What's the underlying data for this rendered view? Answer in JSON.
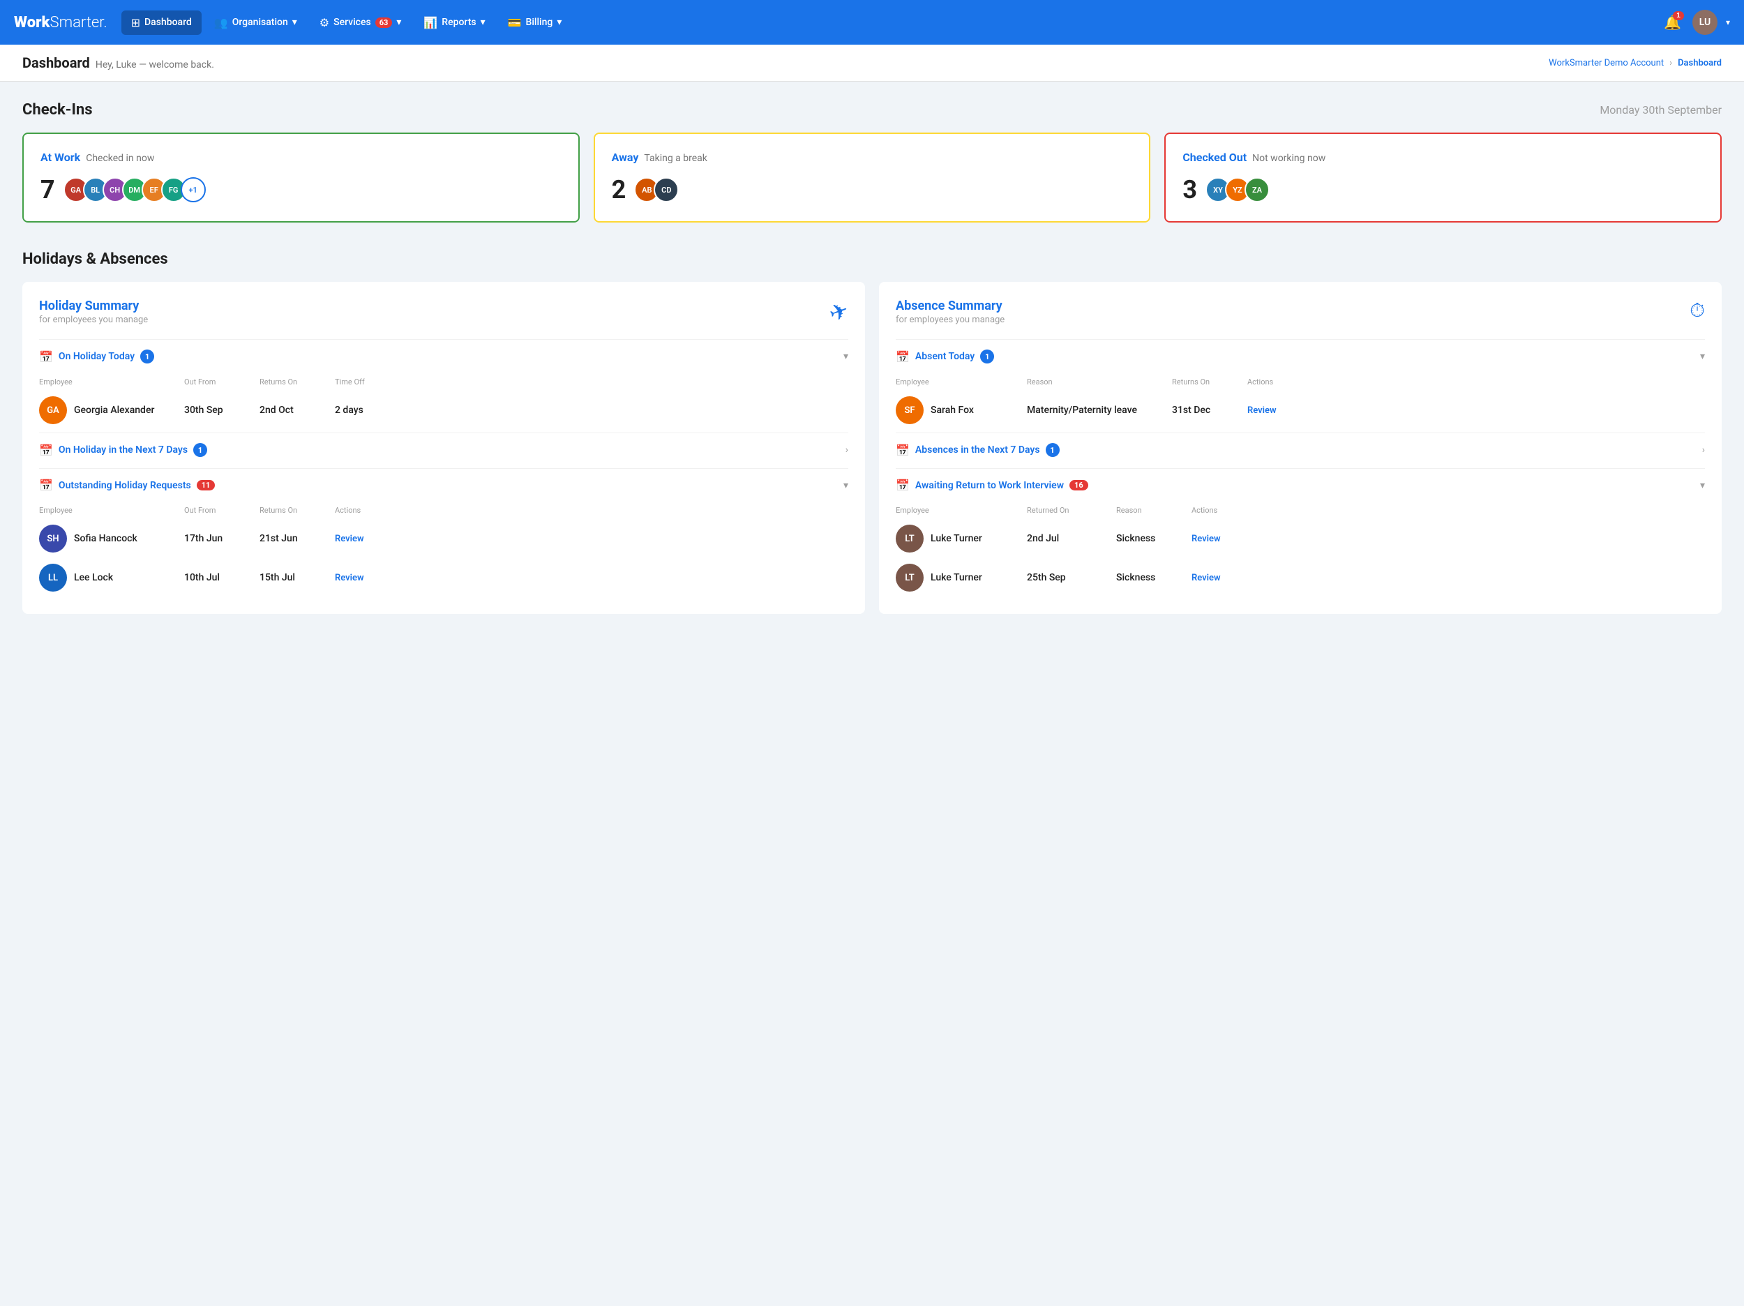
{
  "brand": "WorkSmarter.",
  "nav": {
    "items": [
      {
        "label": "Dashboard",
        "active": true,
        "icon": "⊞"
      },
      {
        "label": "Organisation",
        "active": false,
        "icon": "👥",
        "dropdown": true
      },
      {
        "label": "Services",
        "active": false,
        "icon": "⚙",
        "dropdown": true,
        "badge": "63"
      },
      {
        "label": "Reports",
        "active": false,
        "icon": "📊",
        "dropdown": true
      },
      {
        "label": "Billing",
        "active": false,
        "icon": "💳",
        "dropdown": true
      }
    ],
    "notifications_count": "1",
    "user_initials": "LU"
  },
  "breadcrumb": {
    "title": "Dashboard",
    "subtitle": "Hey, Luke — welcome back.",
    "account_link": "WorkSmarter Demo Account",
    "current": "Dashboard"
  },
  "checkins": {
    "section_title": "Check-Ins",
    "date": "Monday 30th September",
    "cards": [
      {
        "status": "At Work",
        "description": "Checked in now",
        "count": "7",
        "border": "green",
        "avatars": [
          "GA",
          "BL",
          "CH",
          "DM",
          "EF",
          "FG"
        ],
        "extra": "+1"
      },
      {
        "status": "Away",
        "description": "Taking a break",
        "count": "2",
        "border": "yellow",
        "avatars": [
          "AB",
          "CD"
        ],
        "extra": null
      },
      {
        "status": "Checked Out",
        "description": "Not working now",
        "count": "3",
        "border": "red",
        "avatars": [
          "XY",
          "YZ",
          "ZA"
        ],
        "extra": null
      }
    ]
  },
  "holidays_absences": {
    "section_title": "Holidays & Absences",
    "holiday_card": {
      "title": "Holiday Summary",
      "subtitle": "for employees you manage",
      "on_holiday_today": {
        "label": "On Holiday Today",
        "count": "1",
        "employee": {
          "name": "Georgia Alexander",
          "out_from": "30th Sep",
          "returns_on": "2nd Oct",
          "time_off": "2 days"
        },
        "col_labels": [
          "Employee",
          "Out From",
          "Returns On",
          "Time Off"
        ]
      },
      "next_7_days": {
        "label": "On Holiday in the Next 7 Days",
        "count": "1"
      },
      "outstanding_requests": {
        "label": "Outstanding Holiday Requests",
        "count": "11",
        "employees": [
          {
            "name": "Sofia Hancock",
            "out_from": "17th Jun",
            "returns_on": "21st Jun",
            "action": "Review"
          },
          {
            "name": "Lee Lock",
            "out_from": "10th Jul",
            "returns_on": "15th Jul",
            "action": "Review"
          }
        ],
        "col_labels": [
          "Employee",
          "Out From",
          "Returns On",
          "Actions"
        ]
      }
    },
    "absence_card": {
      "title": "Absence Summary",
      "subtitle": "for employees you manage",
      "absent_today": {
        "label": "Absent Today",
        "count": "1",
        "employee": {
          "name": "Sarah Fox",
          "reason": "Maternity/Paternity leave",
          "returns_on": "31st Dec",
          "action": "Review"
        },
        "col_labels": [
          "Employee",
          "Reason",
          "Returns On",
          "Actions"
        ]
      },
      "next_7_days": {
        "label": "Absences in the Next 7 Days",
        "count": "1"
      },
      "return_to_work": {
        "label": "Awaiting Return to Work Interview",
        "count": "16",
        "employees": [
          {
            "name": "Luke Turner",
            "returned_on": "2nd Jul",
            "reason": "Sickness",
            "action": "Review"
          },
          {
            "name": "Luke Turner",
            "returned_on": "25th Sep",
            "reason": "Sickness",
            "action": "Review"
          }
        ],
        "col_labels": [
          "Employee",
          "Returned On",
          "Reason",
          "Actions"
        ]
      }
    }
  }
}
